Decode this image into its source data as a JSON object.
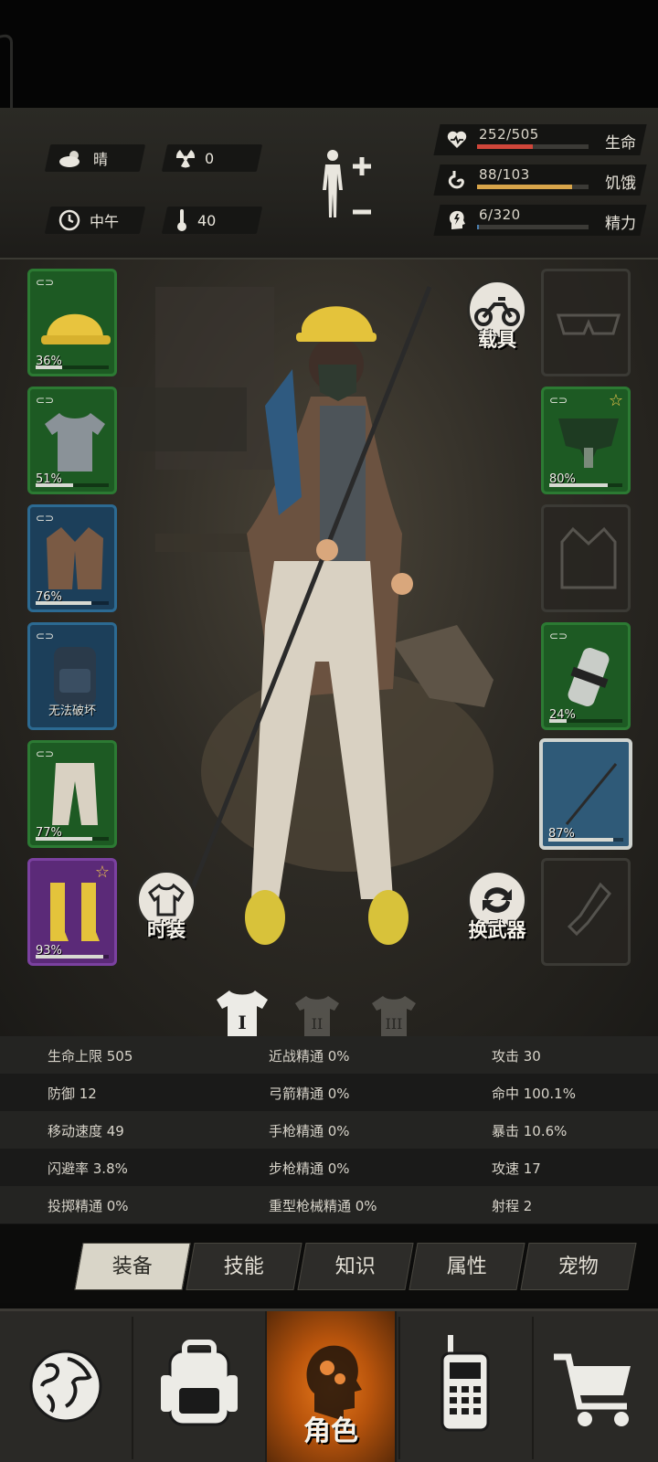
{
  "hud": {
    "weather": "晴",
    "radiation": "0",
    "time_of_day": "中午",
    "temperature": "40",
    "stats": [
      {
        "icon": "heart-icon",
        "value": "252/505",
        "label": "生命",
        "ratio": 0.499,
        "color": "#d0463a"
      },
      {
        "icon": "stomach-icon",
        "value": "88/103",
        "label": "饥饿",
        "ratio": 0.854,
        "color": "#d8a54a"
      },
      {
        "icon": "energy-head-icon",
        "value": "6/320",
        "label": "精力",
        "ratio": 0.019,
        "color": "#4a7fb0"
      }
    ]
  },
  "equipment": {
    "left": [
      {
        "name": "hard-hat",
        "pct": "36%",
        "durability": 0.36,
        "rarity": "green"
      },
      {
        "name": "t-shirt",
        "pct": "51%",
        "durability": 0.51,
        "rarity": "green"
      },
      {
        "name": "coat",
        "pct": "76%",
        "durability": 0.76,
        "rarity": "blue"
      },
      {
        "name": "backpack",
        "note": "无法破坏",
        "rarity": "blue"
      },
      {
        "name": "pants",
        "pct": "77%",
        "durability": 0.77,
        "rarity": "green"
      },
      {
        "name": "boots",
        "pct": "93%",
        "durability": 0.93,
        "rarity": "purple"
      }
    ],
    "right": [
      {
        "name": "glasses-empty"
      },
      {
        "name": "gas-mask",
        "pct": "80%",
        "durability": 0.8,
        "rarity": "green"
      },
      {
        "name": "vest-empty"
      },
      {
        "name": "bandage",
        "pct": "24%",
        "durability": 0.24,
        "rarity": "green"
      },
      {
        "name": "spear",
        "pct": "87%",
        "durability": 0.87,
        "rarity": "selected"
      },
      {
        "name": "throwable-empty"
      }
    ]
  },
  "buttons": {
    "vehicle": "载具",
    "fashion": "时装",
    "switch_weapon": "换武器"
  },
  "outfit_sets": [
    "I",
    "II",
    "III"
  ],
  "stats_table": [
    [
      "生命上限 505",
      "近战精通 0%",
      "攻击 30"
    ],
    [
      "防御 12",
      "弓箭精通 0%",
      "命中 100.1%"
    ],
    [
      "移动速度 49",
      "手枪精通 0%",
      "暴击 10.6%"
    ],
    [
      "闪避率 3.8%",
      "步枪精通 0%",
      "攻速 17"
    ],
    [
      "投掷精通 0%",
      "重型枪械精通 0%",
      "射程 2"
    ]
  ],
  "tabs": [
    "装备",
    "技能",
    "知识",
    "属性",
    "宠物"
  ],
  "nav": {
    "active_label": "角色",
    "items": [
      "globe-icon",
      "backpack-icon",
      "character-icon",
      "walkie-talkie-icon",
      "cart-icon"
    ]
  }
}
